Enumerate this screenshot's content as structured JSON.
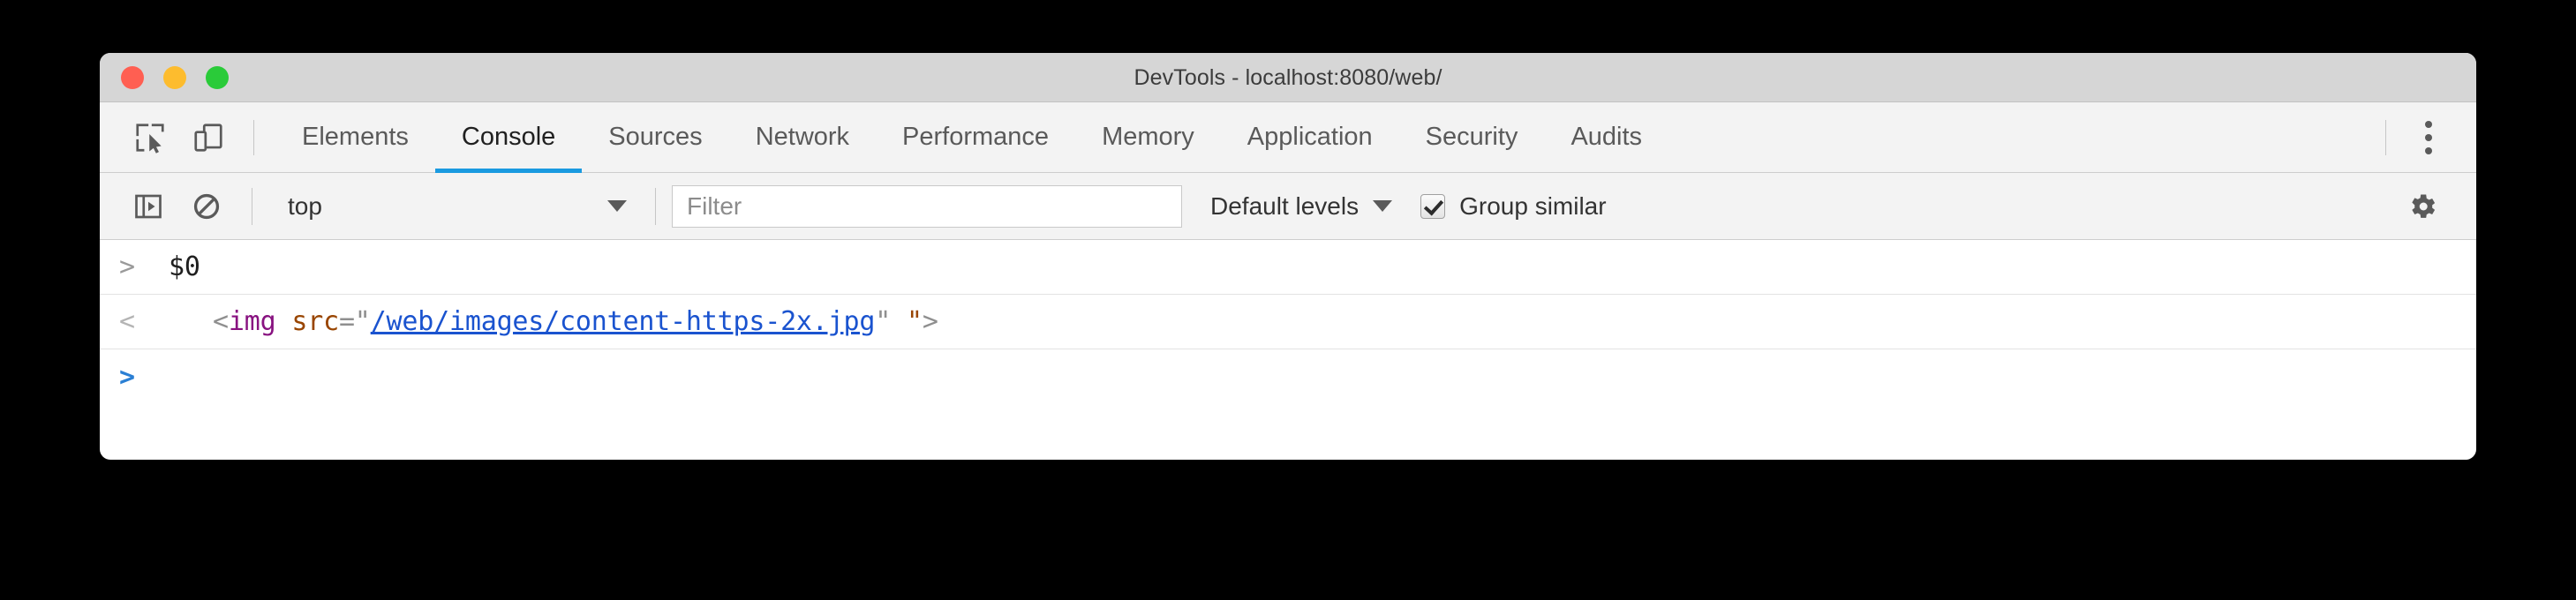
{
  "window": {
    "title": "DevTools - localhost:8080/web/",
    "traffic_lights": [
      {
        "name": "close",
        "color": "#ff5f52"
      },
      {
        "name": "minimize",
        "color": "#fdbc2e"
      },
      {
        "name": "zoom",
        "color": "#2acb39"
      }
    ]
  },
  "toolbar_icons": {
    "inspect": "inspect-element-icon",
    "device": "device-toolbar-icon",
    "more": "more-options-kebab-icon"
  },
  "tabs": [
    {
      "label": "Elements",
      "active": false
    },
    {
      "label": "Console",
      "active": true
    },
    {
      "label": "Sources",
      "active": false
    },
    {
      "label": "Network",
      "active": false
    },
    {
      "label": "Performance",
      "active": false
    },
    {
      "label": "Memory",
      "active": false
    },
    {
      "label": "Application",
      "active": false
    },
    {
      "label": "Security",
      "active": false
    },
    {
      "label": "Audits",
      "active": false
    }
  ],
  "accent_color": "#1a9ae0",
  "console_toolbar": {
    "sidebar_toggle_icon": "console-sidebar-toggle-icon",
    "clear_icon": "clear-console-icon",
    "context": "top",
    "filter_placeholder": "Filter",
    "filter_value": "",
    "levels": "Default levels",
    "group_similar_label": "Group similar",
    "group_similar_checked": true,
    "settings_icon": "gear-icon"
  },
  "console_rows": [
    {
      "type": "input",
      "arrow": ">",
      "text": "$0"
    },
    {
      "type": "output",
      "arrow": "<",
      "text": "<img src=\"/web/images/content-https-2x.jpg\" \">",
      "tokens": {
        "open_bracket": "<",
        "tag": "img",
        "space": " ",
        "attr": "src",
        "eq_quote": "=\"",
        "url": "/web/images/content-https-2x.jpg",
        "close_quote": "\"",
        "gap": " ",
        "stray_quote": "\"",
        "close_bracket": ">"
      }
    },
    {
      "type": "prompt",
      "arrow": ">",
      "text": ""
    }
  ]
}
